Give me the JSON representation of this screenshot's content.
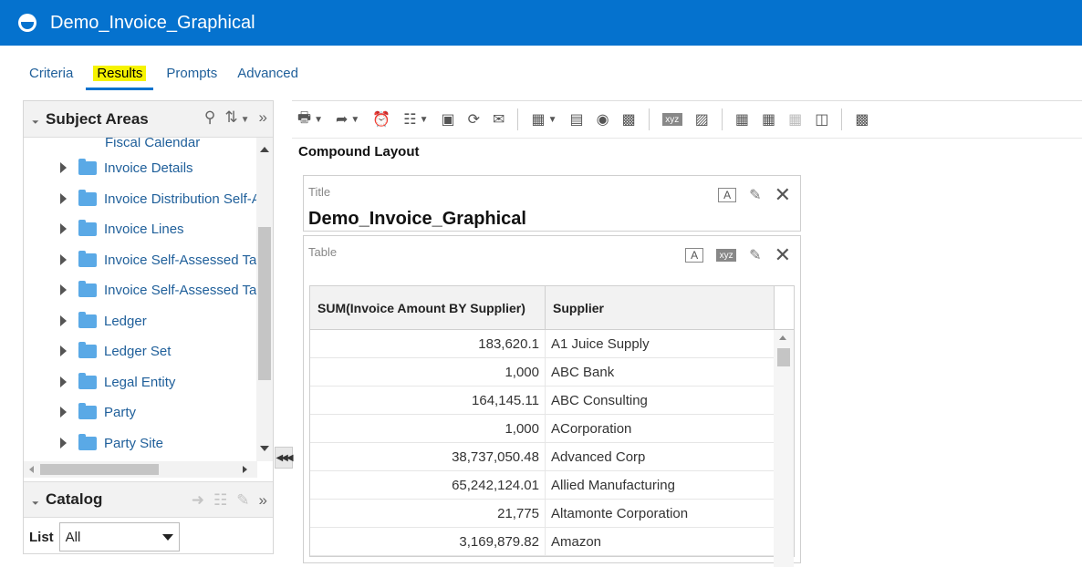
{
  "header": {
    "title": "Demo_Invoice_Graphical"
  },
  "tabs": [
    "Criteria",
    "Results",
    "Prompts",
    "Advanced"
  ],
  "active_tab": "Results",
  "subject_areas": {
    "title": "Subject Areas",
    "partial_item": "Fiscal Calendar",
    "items": [
      "Invoice Details",
      "Invoice Distribution Self-A",
      "Invoice Lines",
      "Invoice Self-Assessed Ta",
      "Invoice Self-Assessed Ta",
      "Ledger",
      "Ledger Set",
      "Legal Entity",
      "Party",
      "Party Site"
    ]
  },
  "catalog": {
    "title": "Catalog",
    "list_label": "List",
    "list_value": "All"
  },
  "compound_layout_label": "Compound Layout",
  "title_view": {
    "label": "Title",
    "title_text": "Demo_Invoice_Graphical"
  },
  "table_view": {
    "label": "Table",
    "xyz_label": "xyz",
    "columns": [
      "SUM(Invoice Amount BY Supplier)",
      "Supplier"
    ],
    "rows": [
      [
        "183,620.1",
        "A1 Juice Supply"
      ],
      [
        "1,000",
        "ABC Bank"
      ],
      [
        "164,145.11",
        "ABC Consulting"
      ],
      [
        "1,000",
        "ACorporation"
      ],
      [
        "38,737,050.48",
        "Advanced Corp"
      ],
      [
        "65,242,124.01",
        "Allied Manufacturing"
      ],
      [
        "21,775",
        "Altamonte Corporation"
      ],
      [
        "3,169,879.82",
        "Amazon"
      ]
    ]
  },
  "colors": {
    "header_bg": "#0572ce",
    "highlight": "#f6f300",
    "link": "#1f5f9a"
  }
}
